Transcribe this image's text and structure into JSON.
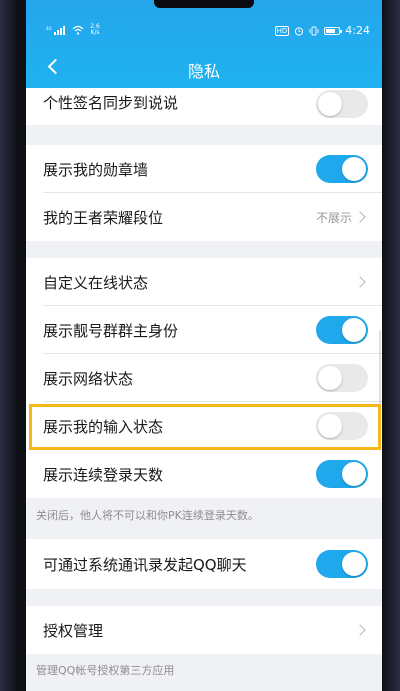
{
  "status_bar": {
    "network_speed": "2.6\nK/s",
    "battery": "83",
    "time": "4:24",
    "icons": [
      "signal-icon",
      "wifi-icon",
      "hd-icon",
      "alarm-icon",
      "vibrate-icon",
      "battery-icon"
    ]
  },
  "header": {
    "title": "隐私",
    "back_icon": "chevron-left-icon",
    "background": "#1fb2f0"
  },
  "rows": {
    "signature_sync": {
      "label": "个性签名同步到说说",
      "enabled": false
    },
    "medal_wall": {
      "label": "展示我的勋章墙",
      "enabled": true
    },
    "honor_rank": {
      "label": "我的王者荣耀段位",
      "value": "不展示"
    },
    "custom_online": {
      "label": "自定义在线状态"
    },
    "vip_group_owner": {
      "label": "展示靓号群群主身份",
      "enabled": true
    },
    "network_status": {
      "label": "展示网络状态",
      "enabled": false
    },
    "typing_status": {
      "label": "展示我的输入状态",
      "enabled": false
    },
    "login_days": {
      "label": "展示连续登录天数",
      "enabled": true
    },
    "login_days_note": "关闭后，他人将不可以和你PK连续登录天数。",
    "contacts_chat": {
      "label": "可通过系统通讯录发起QQ聊天",
      "enabled": true
    },
    "auth_manage": {
      "label": "授权管理"
    },
    "auth_manage_note": "管理QQ帐号授权第三方应用"
  },
  "colors": {
    "accent": "#1fa9ec",
    "highlight": "#f6b818",
    "toggle_off": "#e9e9ea"
  }
}
